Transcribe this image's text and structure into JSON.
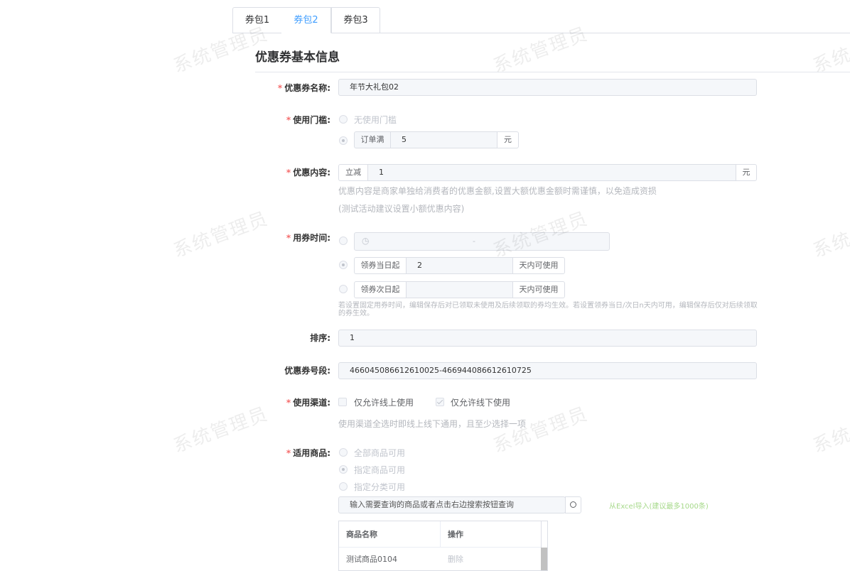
{
  "tabs": [
    {
      "label": "券包1"
    },
    {
      "label": "券包2"
    },
    {
      "label": "券包3"
    }
  ],
  "watermark": "系统管理员",
  "section_title": "优惠券基本信息",
  "form": {
    "name": {
      "label": "优惠券名称:",
      "value": "年节大礼包02"
    },
    "threshold": {
      "label": "使用门槛:",
      "option_none": "无使用门槛",
      "option_order_prefix": "订单满",
      "option_order_value": "5",
      "option_order_suffix": "元"
    },
    "content": {
      "label": "优惠内容:",
      "prefix": "立减",
      "value": "1",
      "suffix": "元",
      "hint1": "优惠内容是商家单独给消费者的优惠金额,设置大额优惠金额时需谨慎，以免造成资损",
      "hint2": "(测试活动建议设置小额优惠内容)"
    },
    "time": {
      "label": "用券时间:",
      "range_separator": "-",
      "same_day_prefix": "领券当日起",
      "same_day_value": "2",
      "same_day_suffix": "天内可使用",
      "next_day_prefix": "领券次日起",
      "next_day_value": "",
      "next_day_suffix": "天内可使用",
      "hint": "若设置固定用券时间，编辑保存后对已领取未使用及后续领取的券均生效。若设置领券当日/次日n天内可用，编辑保存后仅对后续领取的券生效。"
    },
    "sort": {
      "label": "排序:",
      "value": "1"
    },
    "code_range": {
      "label": "优惠券号段:",
      "value": "466045086612610025-466944086612610725"
    },
    "channel": {
      "label": "使用渠道:",
      "online": "仅允许线上使用",
      "offline": "仅允许线下使用",
      "hint": "使用渠道全选时即线上线下通用，且至少选择一项"
    },
    "goods": {
      "label": "适用商品:",
      "option_all": "全部商品可用",
      "option_specific": "指定商品可用",
      "option_category": "指定分类可用",
      "search_placeholder": "输入需要查询的商品或者点击右边搜索按钮查询",
      "import_link": "从Excel导入(建议最多1000条)",
      "table": {
        "headers": [
          "商品名称",
          "操作"
        ],
        "rows": [
          {
            "name": "测试商品0104",
            "action": "删除"
          }
        ]
      }
    }
  },
  "colors": {
    "accent": "#409eff",
    "required": "#f56c6c",
    "link_green": "#67c23a"
  }
}
